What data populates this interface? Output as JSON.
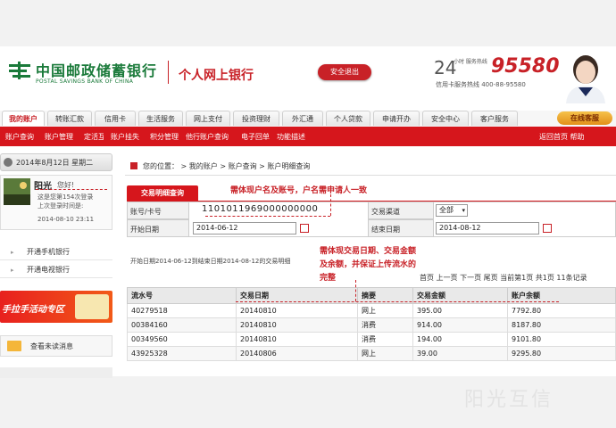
{
  "header": {
    "bank_name_cn": "中国邮政储蓄银行",
    "bank_name_en": "POSTAL SAVINGS BANK OF CHINA",
    "service_title": "个人网上银行",
    "logout_label": "安全退出",
    "hotline_24": "24",
    "hotline_small": "小时 服务热线",
    "hotline_number": "95580",
    "card_line": "信用卡服务热线  400-88-95580"
  },
  "nav": {
    "tabs": [
      "我的账户",
      "转账汇款",
      "信用卡",
      "生活服务",
      "网上支付",
      "投资理财",
      "外汇通",
      "个人贷款",
      "申请开办",
      "安全中心",
      "客户服务"
    ],
    "online_service": "在线客服"
  },
  "subnav": {
    "items": [
      "账户查询",
      "账户管理",
      "定活互转",
      "账户挂失",
      "积分管理",
      "他行账户查询",
      "电子回单",
      "功能描述"
    ],
    "right": "返回首页  帮助"
  },
  "sidebar": {
    "date": "2014年8月12日  星期二",
    "user_name": "阳光",
    "greeting": "您好!",
    "login_line1": "这是您第154次登录",
    "login_line2": "上次登录时间是:",
    "login_time": "2014-08-10 23:11",
    "links": [
      "开通手机银行",
      "开通电视银行"
    ],
    "promo_text": "手拉手活动专区",
    "unread": "查看未读消息"
  },
  "content": {
    "breadcrumb": "您的位置： > 我的账户 > 账户查询 > 账户明细查询",
    "query_tab": "交易明细查询",
    "account_label": "账号/卡号",
    "account_number": "1101011969000000000",
    "channel_label": "交易渠道",
    "channel_value": "全部",
    "start_label": "开始日期",
    "start_date": "2014-06-12",
    "end_label": "结束日期",
    "end_date": "2014-08-12",
    "range_text": "开始日期2014-06-12到结束日期2014-08-12的交易明细",
    "pager": "首页  上一页  下一页  尾页  当前第1页 共1页 11条记录"
  },
  "table": {
    "headers": [
      "流水号",
      "交易日期",
      "摘要",
      "交易金额",
      "账户余额"
    ],
    "rows": [
      [
        "40279518",
        "20140810",
        "网上",
        "395.00",
        "7792.80"
      ],
      [
        "00384160",
        "20140810",
        "消费",
        "914.00",
        "8187.80"
      ],
      [
        "00349560",
        "20140810",
        "消费",
        "194.00",
        "9101.80"
      ],
      [
        "43925328",
        "20140806",
        "网上",
        "39.00",
        "9295.80"
      ]
    ]
  },
  "annotations": {
    "note1": "需体现户名及账号，户名需申请人一致",
    "note2_line1": "需体现交易日期、交易金额",
    "note2_line2": "及余额，并保证上传流水的",
    "note2_line3": "完整"
  },
  "watermark": "阳光互信"
}
